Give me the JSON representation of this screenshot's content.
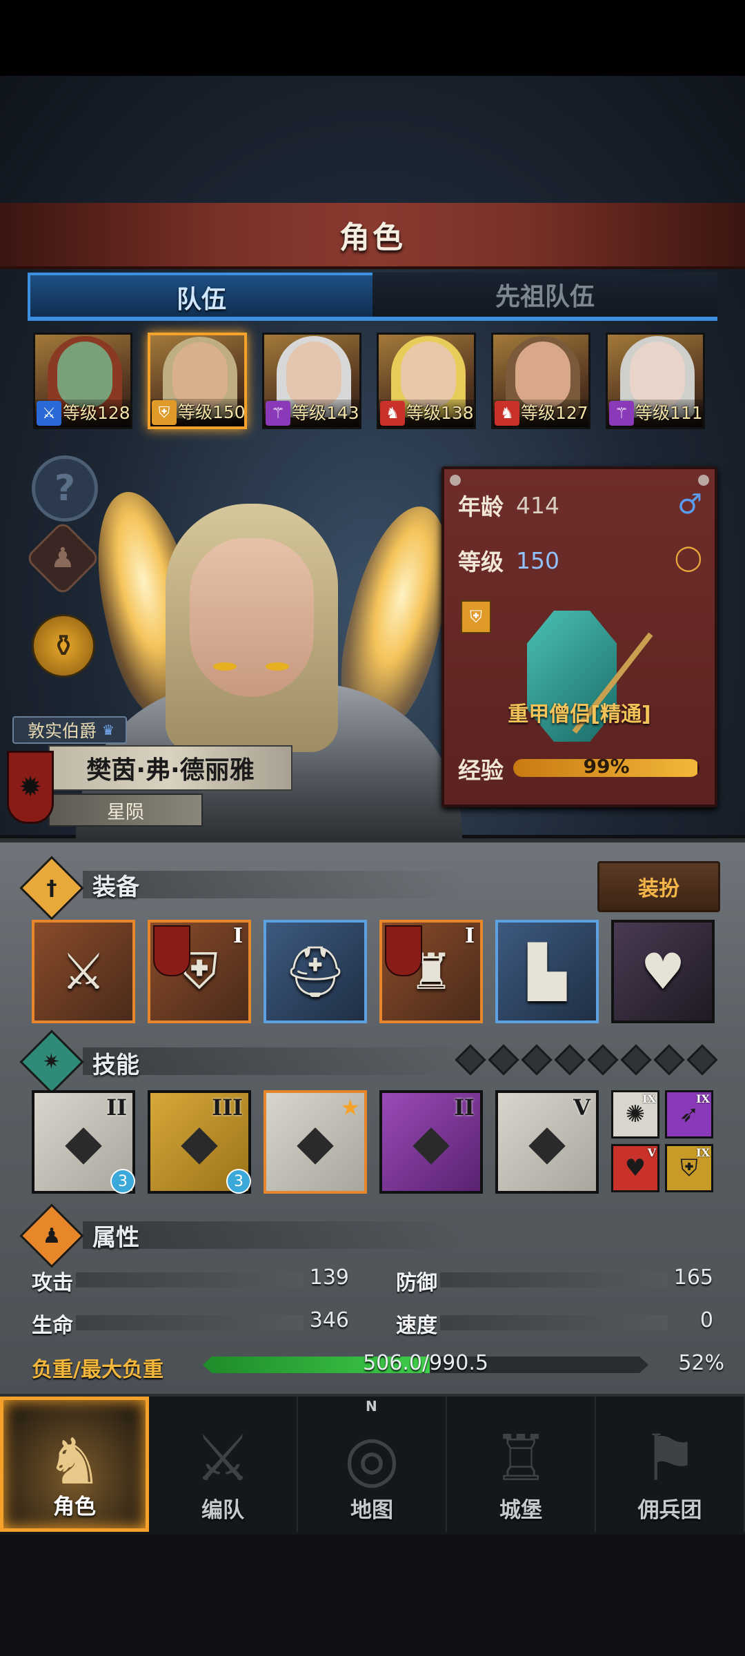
{
  "title": "角色",
  "tabs": {
    "active": "队伍",
    "inactive": "先祖队伍"
  },
  "portraits": [
    {
      "level": "等级128",
      "badge_color": "#2a6ad8",
      "badge_icon": "sword-icon",
      "skin": "#7aa07a",
      "hair": "#8a3a22"
    },
    {
      "level": "等级150",
      "badge_color": "#e09a28",
      "badge_icon": "shield-icon",
      "skin": "#d9b08c",
      "hair": "#bfae82"
    },
    {
      "level": "等级143",
      "badge_color": "#8a3ab8",
      "badge_icon": "staff-icon",
      "skin": "#e4c6b0",
      "hair": "#d8d8d8"
    },
    {
      "level": "等级138",
      "badge_color": "#c8322a",
      "badge_icon": "beast-icon",
      "skin": "#e8c8a8",
      "hair": "#e8cc5a"
    },
    {
      "level": "等级127",
      "badge_color": "#c8322a",
      "badge_icon": "beast-icon",
      "skin": "#d8a888",
      "hair": "#7a5a3a"
    },
    {
      "level": "等级111",
      "badge_color": "#8a3ab8",
      "badge_icon": "staff-icon",
      "skin": "#e8d4c8",
      "hair": "#cfd0cc"
    }
  ],
  "side_icons": [
    "help-icon",
    "body-icon",
    "potion-icon"
  ],
  "hero": {
    "noble_title": "敦实伯爵",
    "name": "樊茵·弗·德丽雅",
    "star": "星陨"
  },
  "info": {
    "age_label": "年龄",
    "age_value": "414",
    "level_label": "等级",
    "level_value": "150",
    "class_name": "重甲僧侣[精通]",
    "exp_label": "经验",
    "exp_text": "99%",
    "exp_fraction": 0.99,
    "gender_icon": "male-icon",
    "ring_icon": "ring-icon"
  },
  "equipment": {
    "title": "装备",
    "outfit_button": "装扮",
    "slots": [
      {
        "name": "weapon-slot",
        "style": "orange",
        "glyph": "⚔",
        "tier": ""
      },
      {
        "name": "shield-slot",
        "style": "orange",
        "glyph": "⛨",
        "tier": "I"
      },
      {
        "name": "helmet-slot",
        "style": "blue",
        "glyph": "⛑",
        "tier": ""
      },
      {
        "name": "armor-slot",
        "style": "orange",
        "glyph": "♜",
        "tier": "I"
      },
      {
        "name": "boots-slot",
        "style": "blue",
        "glyph": "▙",
        "tier": ""
      },
      {
        "name": "amulet-slot",
        "style": "dark",
        "glyph": "♥",
        "tier": ""
      }
    ]
  },
  "skills": {
    "title": "技能",
    "dot_count": 8,
    "slots": [
      {
        "name": "skill-1",
        "style": "gray",
        "tier": "II",
        "badge": "3"
      },
      {
        "name": "skill-2",
        "style": "gold",
        "tier": "III",
        "badge": "3"
      },
      {
        "name": "skill-3",
        "style": "orangeb",
        "tier": "",
        "badge": ""
      },
      {
        "name": "skill-4",
        "style": "purple",
        "tier": "II",
        "badge": ""
      },
      {
        "name": "skill-5",
        "style": "gray",
        "tier": "V",
        "badge": ""
      }
    ],
    "mini": [
      {
        "name": "mini-skill-burst",
        "bg": "#d8d6cc",
        "tier": "IX",
        "glyph": "✺"
      },
      {
        "name": "mini-skill-spear",
        "bg": "#8a3ab8",
        "tier": "IX",
        "glyph": "➶"
      },
      {
        "name": "mini-skill-heart",
        "bg": "#c8322a",
        "tier": "V",
        "glyph": "♥"
      },
      {
        "name": "mini-skill-shield",
        "bg": "#c89a28",
        "tier": "IX",
        "glyph": "⛨"
      }
    ]
  },
  "attributes": {
    "title": "属性",
    "attack_label": "攻击",
    "attack_value": "139",
    "defense_label": "防御",
    "defense_value": "165",
    "hp_label": "生命",
    "hp_value": "346",
    "speed_label": "速度",
    "speed_value": "0",
    "load_label": "负重/最大负重",
    "load_text": "506.0/990.5",
    "load_pct": "52%",
    "load_fraction": 0.51
  },
  "nav": [
    {
      "name": "nav-character",
      "label": "角色",
      "glyph": "♞",
      "active": true
    },
    {
      "name": "nav-formation",
      "label": "编队",
      "glyph": "⚔",
      "active": false
    },
    {
      "name": "nav-map",
      "label": "地图",
      "glyph": "◎",
      "active": false
    },
    {
      "name": "nav-castle",
      "label": "城堡",
      "glyph": "♖",
      "active": false
    },
    {
      "name": "nav-mercenary",
      "label": "佣兵团",
      "glyph": "⚑",
      "active": false
    }
  ],
  "compass_letter": "N"
}
